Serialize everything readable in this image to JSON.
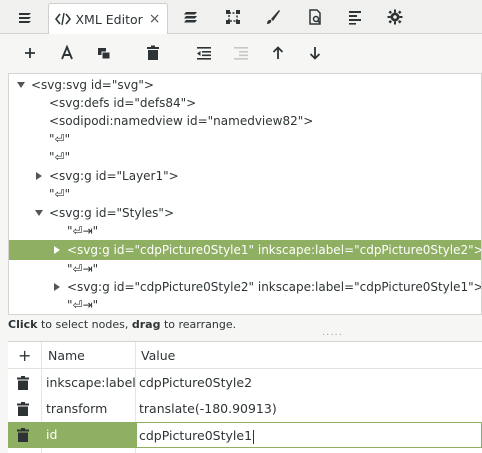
{
  "tabs": {
    "active_label": "XML Editor",
    "active_close": "×"
  },
  "tree": {
    "nodes": [
      {
        "text": "<svg:svg id=\"svg\">"
      },
      {
        "text": "<svg:defs id=\"defs84\">"
      },
      {
        "text": "<sodipodi:namedview id=\"namedview82\">"
      },
      {
        "text": "\"⏎\""
      },
      {
        "text": "\"⏎\""
      },
      {
        "text": "<svg:g id=\"Layer1\">"
      },
      {
        "text": "\"⏎\""
      },
      {
        "text": "<svg:g id=\"Styles\">"
      },
      {
        "text": "\"⏎⇥\""
      },
      {
        "text": "<svg:g id=\"cdpPicture0Style1\" inkscape:label=\"cdpPicture0Style2\">"
      },
      {
        "text": "\"⏎⇥\""
      },
      {
        "text": "<svg:g id=\"cdpPicture0Style2\" inkscape:label=\"cdpPicture0Style1\">"
      },
      {
        "text": "\"⏎⇥\""
      }
    ]
  },
  "hint": {
    "click": "Click",
    "click_rest": " to select nodes, ",
    "drag": "drag",
    "drag_rest": " to rearrange."
  },
  "attributes": {
    "header": {
      "add": "+",
      "name": "Name",
      "value": "Value"
    },
    "rows": [
      {
        "name": "inkscape:label",
        "value": "cdpPicture0Style2"
      },
      {
        "name": "transform",
        "value": "translate(-180.90913)"
      },
      {
        "name": "id",
        "value": "cdpPicture0Style1"
      }
    ]
  },
  "colors": {
    "selection": "#8faf62",
    "text": "#2e3436"
  }
}
